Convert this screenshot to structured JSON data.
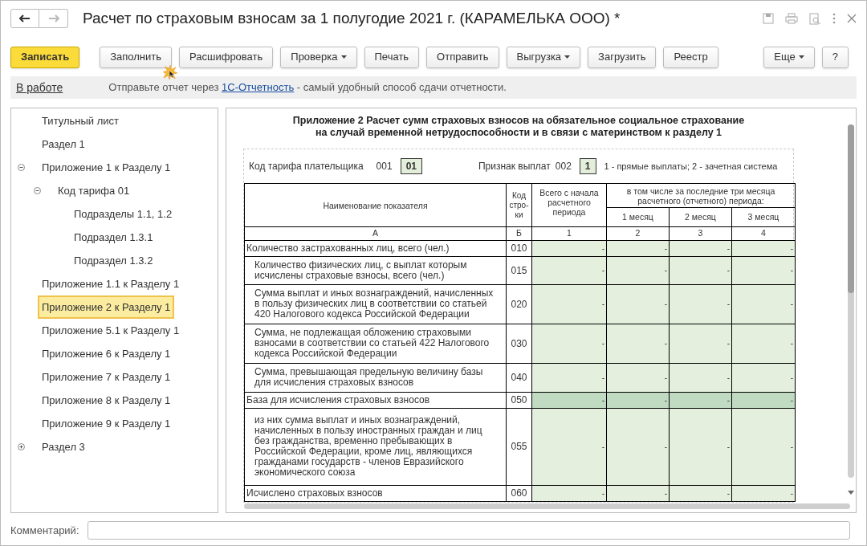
{
  "window": {
    "title": "Расчет по страховым взносам за 1 полугодие 2021 г. (КАРАМЕЛЬКА ООО) *"
  },
  "toolbar": [
    {
      "label": "Записать",
      "kind": "primary"
    },
    {
      "label": "Заполнить",
      "kind": "plain"
    },
    {
      "label": "Расшифровать",
      "kind": "plain"
    },
    {
      "label": "Проверка",
      "kind": "dropdown"
    },
    {
      "label": "Печать",
      "kind": "plain"
    },
    {
      "label": "Отправить",
      "kind": "plain"
    },
    {
      "label": "Выгрузка",
      "kind": "dropdown"
    },
    {
      "label": "Загрузить",
      "kind": "plain"
    },
    {
      "label": "Реестр",
      "kind": "plain"
    }
  ],
  "toolbar_right": [
    {
      "label": "Еще",
      "kind": "dropdown"
    },
    {
      "label": "?",
      "kind": "plain"
    }
  ],
  "info_bar": {
    "status_link": "В работе",
    "text_before": "Отправьте отчет через",
    "link": "1С-Отчетность",
    "text_after": "- самый удобный способ сдачи отчетности."
  },
  "tree": [
    {
      "label": "Титульный лист",
      "selected": false
    },
    {
      "label": "Раздел 1",
      "selected": false
    },
    {
      "label": "Приложение 1 к Разделу 1",
      "selected": false,
      "expanded": true,
      "children": [
        {
          "label": "Код тарифа 01",
          "selected": false,
          "expanded": true,
          "children": [
            {
              "label": "Подразделы 1.1, 1.2",
              "selected": false
            },
            {
              "label": "Подраздел 1.3.1",
              "selected": false
            },
            {
              "label": "Подраздел 1.3.2",
              "selected": false
            }
          ]
        }
      ]
    },
    {
      "label": "Приложение 1.1 к Разделу 1",
      "selected": false
    },
    {
      "label": "Приложение 2 к Разделу 1",
      "selected": true
    },
    {
      "label": "Приложение 5.1 к Разделу 1",
      "selected": false
    },
    {
      "label": "Приложение 6 к Разделу 1",
      "selected": false
    },
    {
      "label": "Приложение 7 к Разделу 1",
      "selected": false
    },
    {
      "label": "Приложение 8 к Разделу 1",
      "selected": false
    },
    {
      "label": "Приложение 9 к Разделу 1",
      "selected": false
    },
    {
      "label": "Раздел 3",
      "selected": false,
      "expanded": false
    }
  ],
  "form": {
    "title": [
      "Приложение 2 Расчет сумм страховых взносов на обязательное социальное страхование",
      "на случай временной нетрудоспособности и в связи с материнством к разделу 1"
    ],
    "tariff": {
      "label": "Код тарифа плательщика",
      "code": "001",
      "value": "01"
    },
    "payments": {
      "label": "Признак выплат",
      "code": "002",
      "value": "1",
      "note": "1 - прямые выплаты; 2 - зачетная система"
    },
    "header": {
      "name": "Наименование показателя",
      "code": "Код стро-ки",
      "total": "Всего с начала расчетного периода",
      "months_group": "в том числе за последние три месяца расчетного (отчетного) периода:",
      "months": [
        "1 месяц",
        "2 месяц",
        "3 месяц"
      ]
    },
    "column_numbers": [
      "А",
      "Б",
      "1",
      "2",
      "3",
      "4"
    ],
    "rows": [
      {
        "name": "Количество застрахованных лиц, всего (чел.)",
        "code": "010",
        "values": [
          "-",
          "-",
          "-",
          "-"
        ],
        "highlighted": false,
        "indented": false
      },
      {
        "name": "Количество физических лиц, с выплат которым исчислены страховые взносы, всего (чел.)",
        "code": "015",
        "values": [
          "-",
          "-",
          "-",
          "-"
        ],
        "highlighted": false,
        "indented": true
      },
      {
        "name": "Сумма выплат и иных вознаграждений, начисленных в пользу физических лиц в соответствии со статьей 420 Налогового кодекса Российской Федерации",
        "code": "020",
        "values": [
          "-",
          "-",
          "-",
          "-"
        ],
        "highlighted": false,
        "indented": true
      },
      {
        "name": "Сумма, не подлежащая обложению страховыми взносами в соответствии со статьей 422 Налогового кодекса Российской Федерации",
        "code": "030",
        "values": [
          "-",
          "-",
          "-",
          "-"
        ],
        "highlighted": false,
        "indented": true
      },
      {
        "name": "Сумма, превышающая предельную величину базы для исчисления страховых взносов",
        "code": "040",
        "values": [
          "-",
          "-",
          "-",
          "-"
        ],
        "highlighted": false,
        "indented": true
      },
      {
        "name": "База для исчисления страховых взносов",
        "code": "050",
        "values": [
          "-",
          "-",
          "-",
          "-"
        ],
        "highlighted": true,
        "indented": false
      },
      {
        "name": "из них сумма выплат и иных вознаграждений, начисленных в пользу иностранных граждан и лиц без гражданства, временно пребывающих в Российской Федерации, кроме лиц, являющихся гражданами государств - членов Евразийского экономического союза",
        "code": "055",
        "values": [
          "-",
          "-",
          "-",
          "-"
        ],
        "highlighted": false,
        "indented": true
      },
      {
        "name": "Исчислено страховых взносов",
        "code": "060",
        "values": [
          "-",
          "-",
          "-",
          "-"
        ],
        "highlighted": false,
        "indented": false
      }
    ]
  },
  "comment": {
    "label": "Комментарий:"
  }
}
